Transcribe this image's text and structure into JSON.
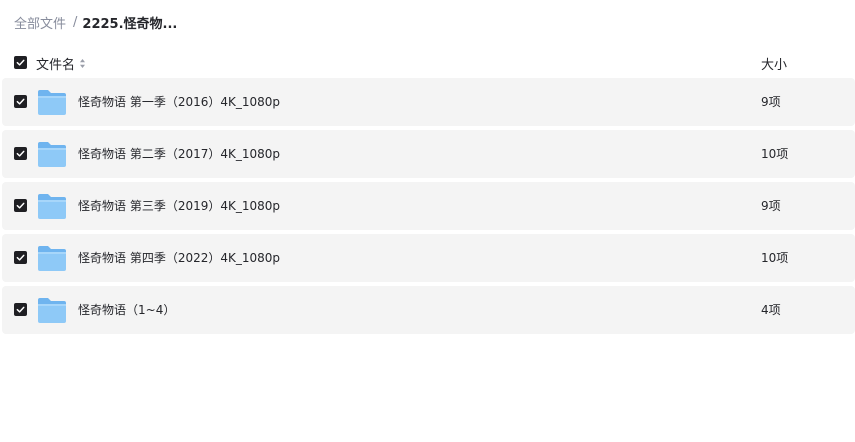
{
  "breadcrumb": {
    "root": "全部文件",
    "separator": "/",
    "current": "2225.怪奇物..."
  },
  "header": {
    "name_label": "文件名",
    "size_label": "大小",
    "all_selected": true
  },
  "files": [
    {
      "name": "怪奇物语 第一季（2016）4K_1080p",
      "size": "9项",
      "selected": true,
      "icon": "folder-icon"
    },
    {
      "name": "怪奇物语 第二季（2017）4K_1080p",
      "size": "10项",
      "selected": true,
      "icon": "folder-icon"
    },
    {
      "name": "怪奇物语 第三季（2019）4K_1080p",
      "size": "9项",
      "selected": true,
      "icon": "folder-icon"
    },
    {
      "name": "怪奇物语 第四季（2022）4K_1080p",
      "size": "10项",
      "selected": true,
      "icon": "folder-icon"
    },
    {
      "name": "怪奇物语（1~4）",
      "size": "4项",
      "selected": true,
      "icon": "folder-icon"
    }
  ],
  "colors": {
    "row_bg": "#f4f4f4",
    "checkbox": "#1f1f23",
    "muted_text": "#878c9c",
    "folder_blue": "#8ec9f7"
  }
}
